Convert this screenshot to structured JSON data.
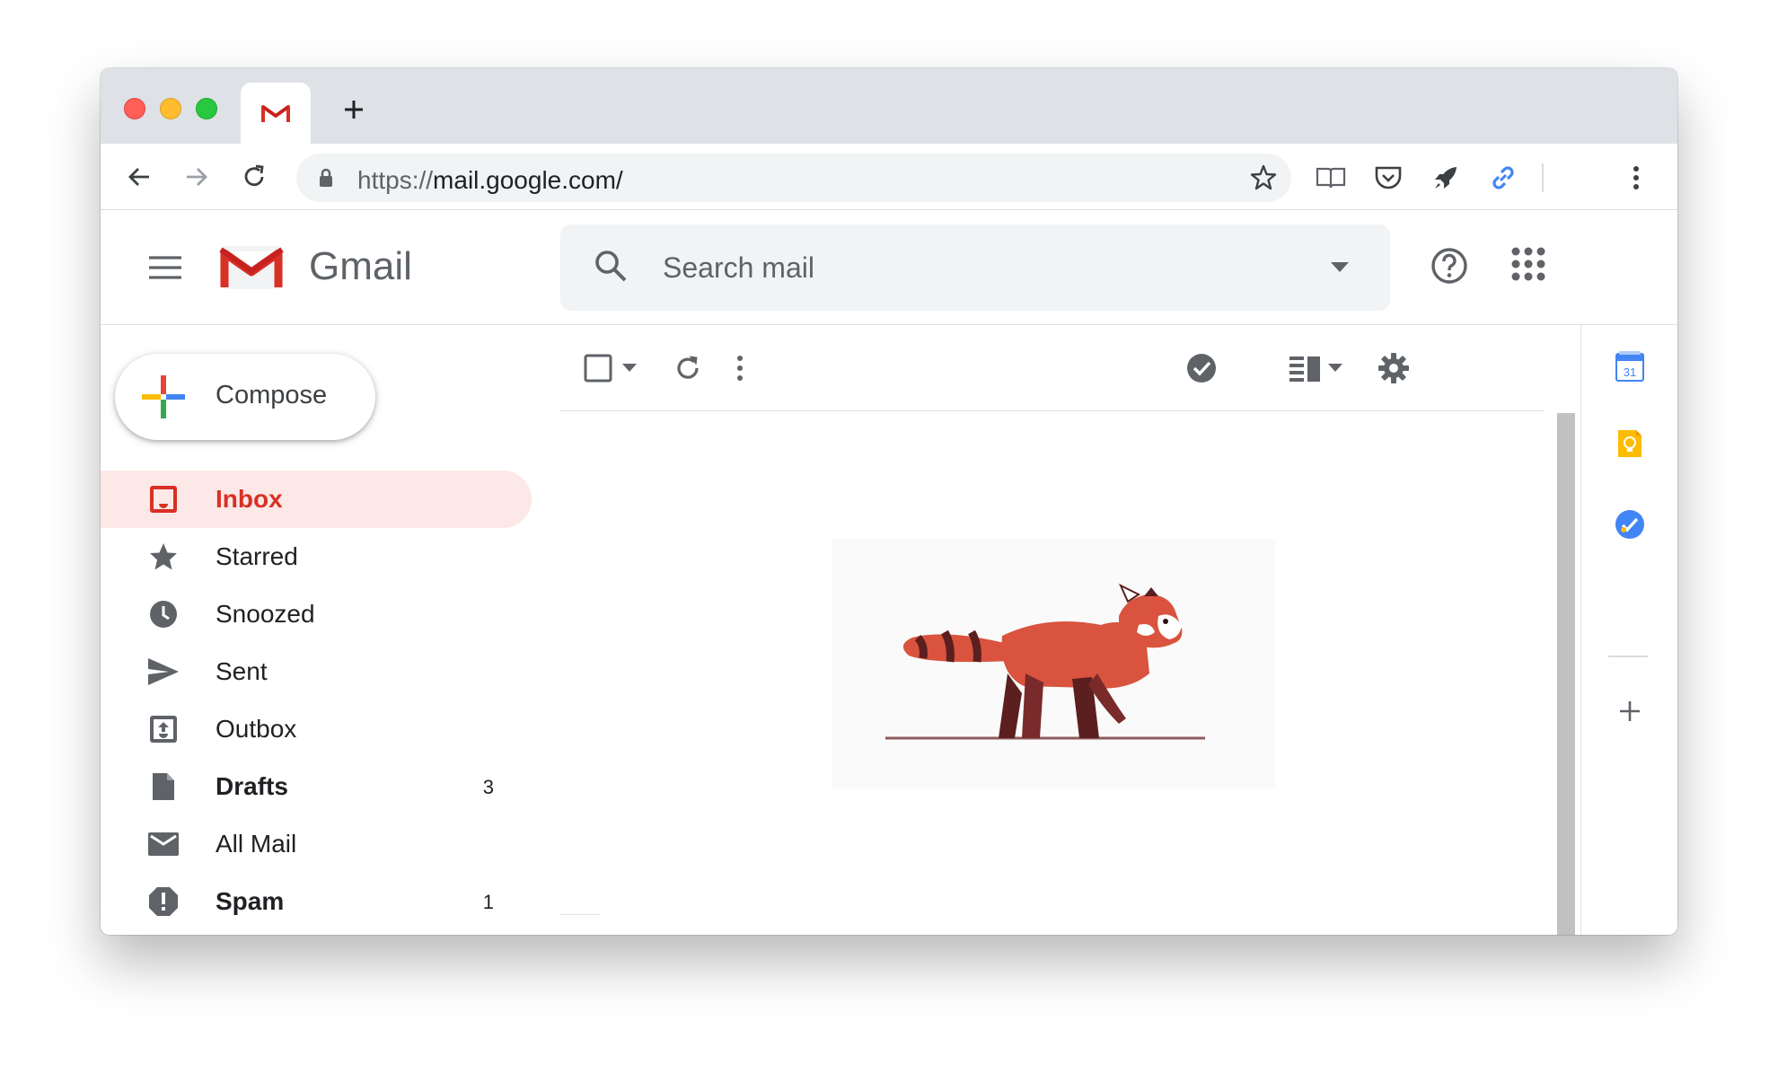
{
  "browser": {
    "url_scheme": "https://",
    "url_host": "mail.google.com/",
    "tab_favicon": "gmail-logo-icon"
  },
  "gmail": {
    "product_name": "Gmail",
    "search_placeholder": "Search mail",
    "compose_label": "Compose",
    "nav": [
      {
        "label": "Inbox",
        "icon": "inbox-icon",
        "count": "",
        "active": true,
        "bold": true
      },
      {
        "label": "Starred",
        "icon": "star-icon",
        "count": "",
        "active": false,
        "bold": false
      },
      {
        "label": "Snoozed",
        "icon": "clock-icon",
        "count": "",
        "active": false,
        "bold": false
      },
      {
        "label": "Sent",
        "icon": "send-icon",
        "count": "",
        "active": false,
        "bold": false
      },
      {
        "label": "Outbox",
        "icon": "outbox-icon",
        "count": "",
        "active": false,
        "bold": false
      },
      {
        "label": "Drafts",
        "icon": "draft-icon",
        "count": "3",
        "active": false,
        "bold": true
      },
      {
        "label": "All Mail",
        "icon": "mail-icon",
        "count": "",
        "active": false,
        "bold": false
      },
      {
        "label": "Spam",
        "icon": "spam-icon",
        "count": "1",
        "active": false,
        "bold": true
      }
    ],
    "calendar_day": "31"
  },
  "colors": {
    "accent_red": "#d93025",
    "active_bg": "#fce8e6",
    "link_blue": "#4285f4"
  }
}
